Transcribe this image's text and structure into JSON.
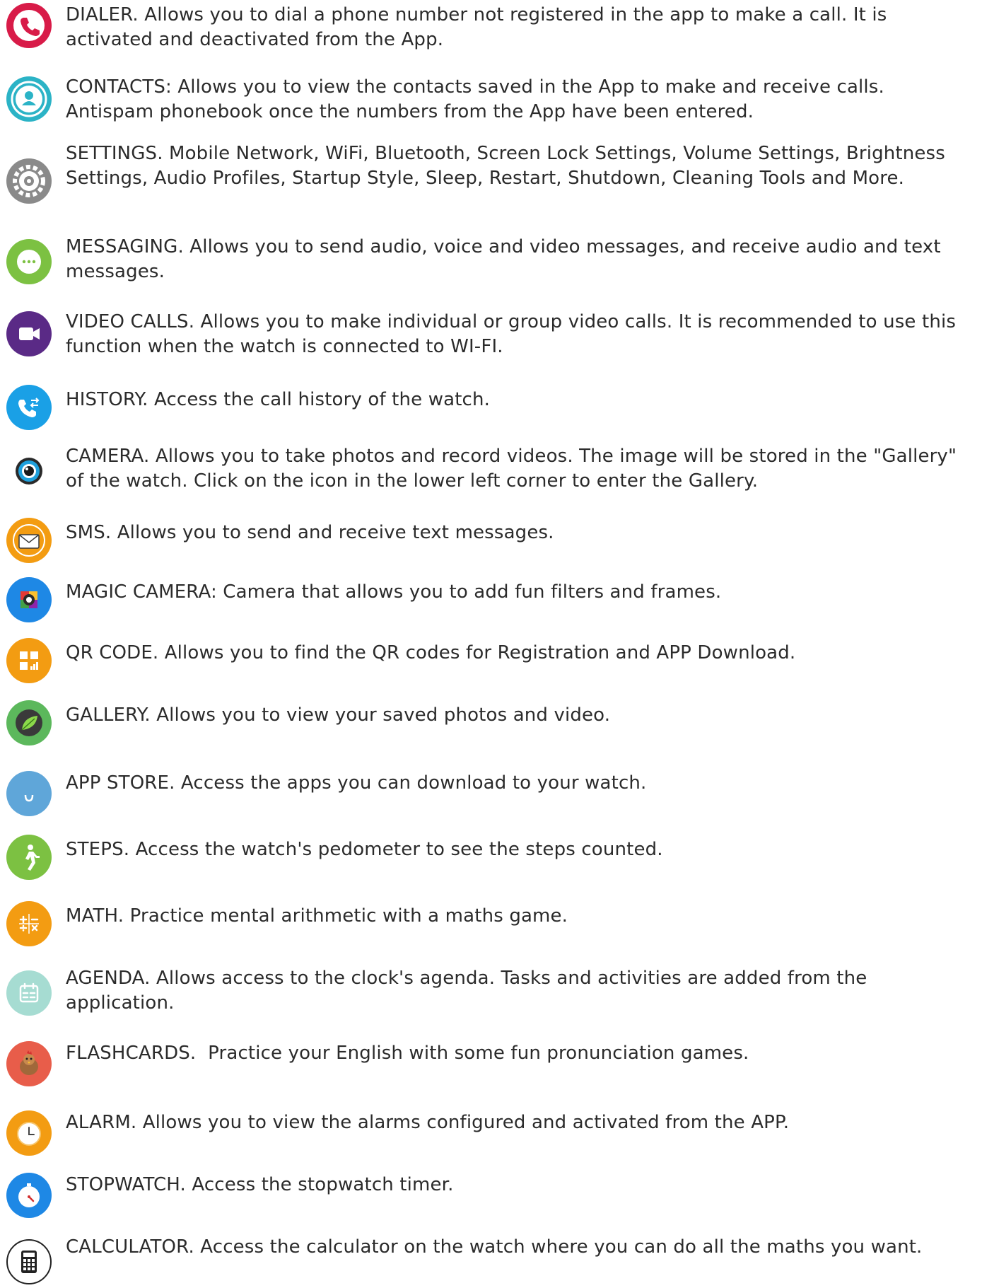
{
  "colors": {
    "text": "#2b2b2b",
    "dialer": "#d81b48",
    "contacts": "#2bb3c6",
    "settings": "#8a8a8a",
    "messaging": "#7cc142",
    "video_calls": "#5a2a86",
    "history": "#1aa0e6",
    "camera": "#2a2a2a",
    "sms": "#f39c12",
    "magic_camera": "#1e88e5",
    "qr_code": "#f39c12",
    "gallery": "#5cb85c",
    "app_store": "#5fa6d9",
    "steps": "#7cc142",
    "math": "#f39c12",
    "agenda": "#a6dcd2",
    "flashcards": "#e85d4a",
    "alarm": "#f39c12",
    "stopwatch": "#1e88e5",
    "calculator": "#222222"
  },
  "items": [
    {
      "icon": "phone-icon",
      "text": "DIALER. Allows you to dial a phone number not registered in the app to make a call. It is activated and deactivated from the App."
    },
    {
      "icon": "contact-icon",
      "text": "CONTACTS: Allows you to view the contacts saved in the App to make and receive calls. Antispam phonebook once the numbers from the App have been entered."
    },
    {
      "icon": "gear-icon",
      "text": "SETTINGS. Mobile Network, WiFi, Bluetooth, Screen Lock Settings, Volume Settings, Brightness Settings, Audio Profiles, Startup Style, Sleep, Restart, Shutdown, Cleaning Tools and More."
    },
    {
      "icon": "chat-bubble-icon",
      "text": "MESSAGING. Allows you to send audio, voice and video messages, and receive audio and text messages."
    },
    {
      "icon": "video-camera-icon",
      "text": "VIDEO CALLS. Allows you to make individual or group video calls. It is recommended to use this function when the watch is connected to WI-FI."
    },
    {
      "icon": "call-history-icon",
      "text": "HISTORY. Access the call history of the watch."
    },
    {
      "icon": "camera-lens-icon",
      "text": "CAMERA. Allows you to take photos and record videos. The image will be stored in the \"Gallery\" of the watch. Click on the icon in the lower left corner to enter the Gallery."
    },
    {
      "icon": "envelope-icon",
      "text": "SMS. Allows you to send and receive text messages."
    },
    {
      "icon": "magic-camera-icon",
      "text": "MAGIC CAMERA: Camera that allows you to add fun filters and frames."
    },
    {
      "icon": "qr-code-icon",
      "text": "QR CODE. Allows you to find the QR codes for Registration and APP Download."
    },
    {
      "icon": "gallery-leaf-icon",
      "text": "GALLERY. Allows you to view your saved photos and video."
    },
    {
      "icon": "app-store-icon",
      "text": "APP STORE. Access the apps you can download to your watch."
    },
    {
      "icon": "walking-person-icon",
      "text": "STEPS. Access the watch's pedometer to see the steps counted."
    },
    {
      "icon": "math-operators-icon",
      "text": "MATH. Practice mental arithmetic with a maths game."
    },
    {
      "icon": "calendar-icon",
      "text": "AGENDA. Allows access to the clock's agenda. Tasks and activities are added from the application."
    },
    {
      "icon": "chicken-icon",
      "text": "FLASHCARDS.  Practice your English with some fun pronunciation games."
    },
    {
      "icon": "alarm-clock-icon",
      "text": "ALARM. Allows you to view the alarms configured and activated from the APP."
    },
    {
      "icon": "stopwatch-icon",
      "text": "STOPWATCH. Access the stopwatch timer."
    },
    {
      "icon": "calculator-icon",
      "text": "CALCULATOR. Access the calculator on the watch where you can do all the maths you want."
    }
  ]
}
